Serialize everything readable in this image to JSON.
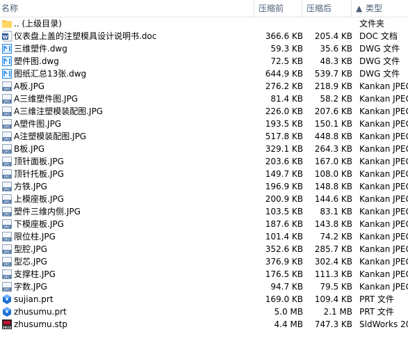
{
  "columns": {
    "name": "名称",
    "original_size": "压缩前",
    "compressed_size": "压缩后",
    "type": "类型",
    "sort_indicator": "▲"
  },
  "files": [
    {
      "name": ".. (上级目录)",
      "icon": "folder-icon",
      "original_size": "",
      "compressed_size": "",
      "type": "文件夹"
    },
    {
      "name": "仪表盘上盖的注塑模具设计说明书.doc",
      "icon": "word-doc-icon",
      "original_size": "366.6 KB",
      "compressed_size": "205.4 KB",
      "type": "DOC 文档"
    },
    {
      "name": "三维塑件.dwg",
      "icon": "dwg-icon",
      "original_size": "59.3 KB",
      "compressed_size": "35.6 KB",
      "type": "DWG 文件"
    },
    {
      "name": "塑件图.dwg",
      "icon": "dwg-icon",
      "original_size": "72.5 KB",
      "compressed_size": "48.3 KB",
      "type": "DWG 文件"
    },
    {
      "name": "图纸汇总13张.dwg",
      "icon": "dwg-icon",
      "original_size": "644.9 KB",
      "compressed_size": "539.7 KB",
      "type": "DWG 文件"
    },
    {
      "name": "A板.JPG",
      "icon": "jpg-icon",
      "original_size": "276.2 KB",
      "compressed_size": "218.9 KB",
      "type": "Kankan JPEG"
    },
    {
      "name": "A三维塑件图.JPG",
      "icon": "jpg-icon",
      "original_size": "81.4 KB",
      "compressed_size": "58.2 KB",
      "type": "Kankan JPEG"
    },
    {
      "name": "A三维注塑模装配图.JPG",
      "icon": "jpg-icon",
      "original_size": "226.0 KB",
      "compressed_size": "207.6 KB",
      "type": "Kankan JPEG"
    },
    {
      "name": "A塑件图.JPG",
      "icon": "jpg-icon",
      "original_size": "193.5 KB",
      "compressed_size": "150.1 KB",
      "type": "Kankan JPEG"
    },
    {
      "name": "A注塑模装配图.JPG",
      "icon": "jpg-icon",
      "original_size": "517.8 KB",
      "compressed_size": "448.8 KB",
      "type": "Kankan JPEG"
    },
    {
      "name": "B板.JPG",
      "icon": "jpg-icon",
      "original_size": "329.1 KB",
      "compressed_size": "264.3 KB",
      "type": "Kankan JPEG"
    },
    {
      "name": "顶针面板.JPG",
      "icon": "jpg-icon",
      "original_size": "203.6 KB",
      "compressed_size": "167.0 KB",
      "type": "Kankan JPEG"
    },
    {
      "name": "顶针托板.JPG",
      "icon": "jpg-icon",
      "original_size": "149.7 KB",
      "compressed_size": "108.0 KB",
      "type": "Kankan JPEG"
    },
    {
      "name": "方铁.JPG",
      "icon": "jpg-icon",
      "original_size": "196.9 KB",
      "compressed_size": "148.8 KB",
      "type": "Kankan JPEG"
    },
    {
      "name": "上模座板.JPG",
      "icon": "jpg-icon",
      "original_size": "200.9 KB",
      "compressed_size": "144.6 KB",
      "type": "Kankan JPEG"
    },
    {
      "name": "塑件三维内侧.JPG",
      "icon": "jpg-icon",
      "original_size": "103.5 KB",
      "compressed_size": "83.1 KB",
      "type": "Kankan JPEG"
    },
    {
      "name": "下模座板.JPG",
      "icon": "jpg-icon",
      "original_size": "187.6 KB",
      "compressed_size": "143.8 KB",
      "type": "Kankan JPEG"
    },
    {
      "name": "限位柱.JPG",
      "icon": "jpg-icon",
      "original_size": "101.4 KB",
      "compressed_size": "74.2 KB",
      "type": "Kankan JPEG"
    },
    {
      "name": "型腔.JPG",
      "icon": "jpg-icon",
      "original_size": "352.6 KB",
      "compressed_size": "285.7 KB",
      "type": "Kankan JPEG"
    },
    {
      "name": "型芯.JPG",
      "icon": "jpg-icon",
      "original_size": "376.9 KB",
      "compressed_size": "302.4 KB",
      "type": "Kankan JPEG"
    },
    {
      "name": "支撑柱.JPG",
      "icon": "jpg-icon",
      "original_size": "176.5 KB",
      "compressed_size": "111.3 KB",
      "type": "Kankan JPEG"
    },
    {
      "name": "字数.JPG",
      "icon": "jpg-icon",
      "original_size": "94.7 KB",
      "compressed_size": "79.5 KB",
      "type": "Kankan JPEG"
    },
    {
      "name": "sujian.prt",
      "icon": "prt-icon",
      "original_size": "169.0 KB",
      "compressed_size": "109.4 KB",
      "type": "PRT 文件"
    },
    {
      "name": "zhusumu.prt",
      "icon": "prt-icon",
      "original_size": "5.0 MB",
      "compressed_size": "2.1 MB",
      "type": "PRT 文件"
    },
    {
      "name": "zhusumu.stp",
      "icon": "solidworks-icon",
      "original_size": "4.4 MB",
      "compressed_size": "747.3 KB",
      "type": "SldWorks 20"
    }
  ],
  "icon_badges": {
    "jpg": "JPG",
    "solidworks": "2022"
  },
  "colors": {
    "header_text": "#4c607a",
    "folder": "#f5c74d",
    "word": "#2b579a",
    "dwg": "#1e88e5",
    "jpg": "#5a7ea8",
    "prt": "#1f6fd1",
    "solidworks": "#c8102e"
  }
}
